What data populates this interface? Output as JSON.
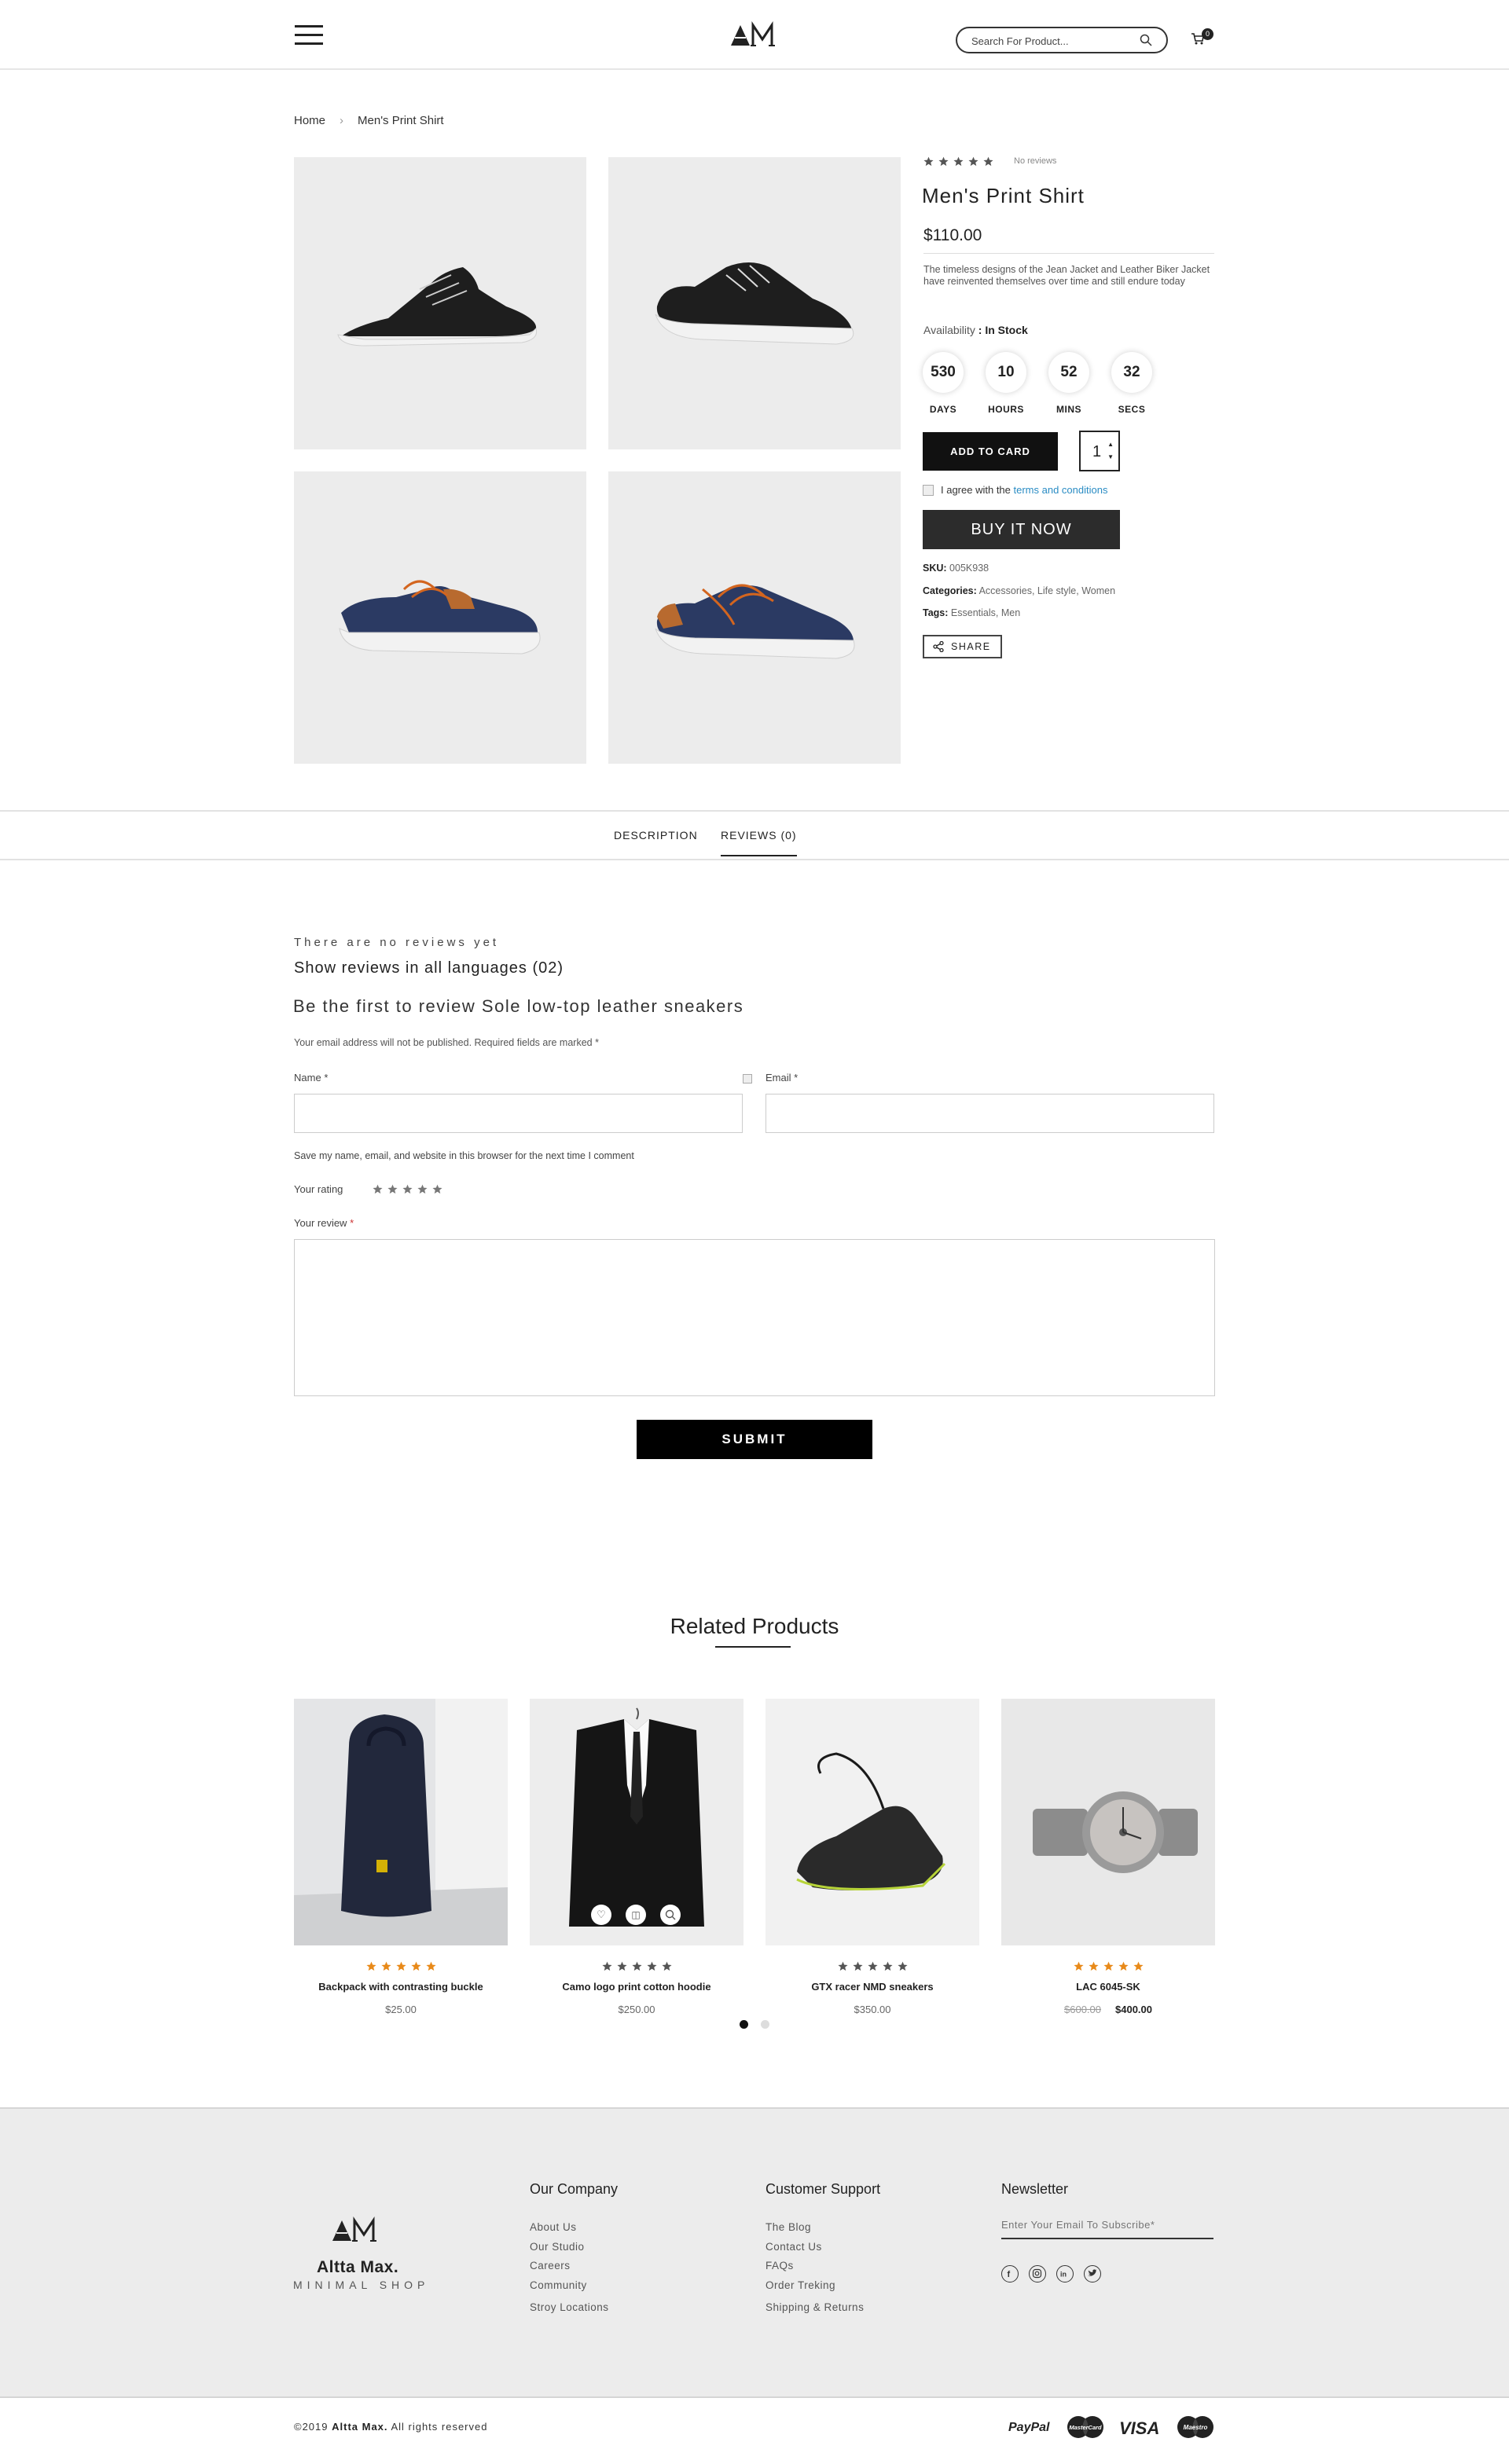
{
  "header": {
    "search_placeholder": "Search For Product...",
    "cart_count": "0"
  },
  "breadcrumb": {
    "home": "Home",
    "current": "Men's Print Shirt"
  },
  "product": {
    "rating": 0,
    "reviews_text": "No reviews",
    "name": "Men's Print Shirt",
    "price": "$110.00",
    "description": "The timeless designs of the Jean Jacket and Leather Biker Jacket have reinvented themselves over time and still endure today",
    "availability_label": "Availability",
    "availability_value": ": In Stock",
    "countdown": [
      {
        "value": "530",
        "label": "DAYS"
      },
      {
        "value": "10",
        "label": "HOURS"
      },
      {
        "value": "52",
        "label": "MINS"
      },
      {
        "value": "32",
        "label": "SECS"
      }
    ],
    "add_to_cart": "ADD TO CARD",
    "quantity": "1",
    "agree_text": "I agree with the",
    "terms_link": "terms and conditions",
    "buy_now": "BUY IT NOW",
    "sku_label": "SKU:",
    "sku_value": "005K938",
    "categories_label": "Categories:",
    "categories": [
      "Accessories",
      "Life style",
      "Women"
    ],
    "tags_label": "Tags:",
    "tags": [
      "Essentials",
      "Men"
    ],
    "share": "SHARE"
  },
  "tabs": [
    {
      "label": "DESCRIPTION",
      "active": false
    },
    {
      "label": "REVIEWS (0)",
      "active": true
    }
  ],
  "reviews": {
    "no_reviews": "There are no reviews yet",
    "show_all": "Show reviews in all languages",
    "show_all_count": "(02)",
    "first_review": "Be the first to review Sole low-top leather sneakers",
    "notice": "Your email address will not be published. Required fields are marked",
    "required_mark": "*",
    "name_label": "Name",
    "email_label": "Email",
    "save_info": "Save my name, email, and website in this browser for the next time I comment",
    "rating_label": "Your rating",
    "review_label": "Your review",
    "submit": "SUBMIT"
  },
  "related": {
    "title": "Related Products",
    "products": [
      {
        "name": "Backpack with contrasting buckle",
        "price": "$25.00",
        "rating_color": "#e88a1a"
      },
      {
        "name": "Camo logo print cotton hoodie",
        "price": "$250.00",
        "rating_color": "#555555"
      },
      {
        "name": "GTX racer NMD sneakers",
        "price": "$350.00",
        "rating_color": "#555555"
      },
      {
        "name": "LAC 6045-SK",
        "old_price": "$600.00",
        "price": "$400.00",
        "rating_color": "#e88a1a"
      }
    ],
    "active_page": 1,
    "total_pages": 2
  },
  "footer": {
    "brand": "Altta Max.",
    "tagline": "MINIMAL SHOP",
    "company_title": "Our Company",
    "company_links": [
      "About Us",
      "Our Studio",
      "Careers",
      "Community",
      "Stroy Locations"
    ],
    "support_title": "Customer Support",
    "support_links": [
      "The Blog",
      "Contact Us",
      "FAQs",
      "Order Treking",
      "Shipping & Returns"
    ],
    "newsletter_title": "Newsletter",
    "newsletter_placeholder": "Enter Your Email To Subscribe*",
    "social_icons": [
      "facebook-icon",
      "instagram-icon",
      "linkedin-icon",
      "twitter-icon"
    ],
    "copyright_prefix": "©2019",
    "copyright_brand": "Altta Max.",
    "copyright_suffix": "All rights reserved",
    "payments": [
      "PayPal",
      "MasterCard",
      "VISA",
      "Maestro"
    ]
  },
  "colors": {
    "accent_link": "#2a8cc4",
    "star_orange": "#e88a1a",
    "dark": "#111111",
    "footer_bg": "#ececec"
  }
}
